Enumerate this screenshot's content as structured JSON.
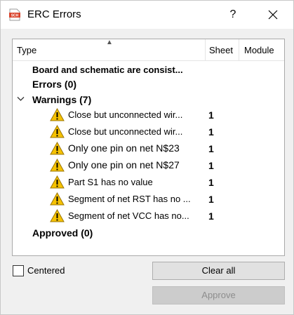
{
  "window": {
    "title": "ERC Errors",
    "help_label": "?",
    "app_icon_text": "SCH"
  },
  "table": {
    "columns": [
      "Type",
      "Sheet",
      "Module"
    ],
    "rows": [
      {
        "kind": "group",
        "label": "Board and schematic are consist..."
      },
      {
        "kind": "group",
        "label": "Errors (0)"
      },
      {
        "kind": "group",
        "label": "Warnings (7)",
        "expanded": true
      },
      {
        "kind": "warning",
        "message": "Close but unconnected wir...",
        "sheet": "1"
      },
      {
        "kind": "warning",
        "message": "Close but unconnected wir...",
        "sheet": "1"
      },
      {
        "kind": "warning",
        "message": "Only one pin on net N$23",
        "sheet": "1"
      },
      {
        "kind": "warning",
        "message": "Only one pin on net N$27",
        "sheet": "1"
      },
      {
        "kind": "warning",
        "message": "Part S1 has no value",
        "sheet": "1"
      },
      {
        "kind": "warning",
        "message": "Segment of net RST has no ...",
        "sheet": "1"
      },
      {
        "kind": "warning",
        "message": "Segment of net VCC has no...",
        "sheet": "1"
      },
      {
        "kind": "group",
        "label": "Approved (0)"
      }
    ]
  },
  "footer": {
    "centered_label": "Centered",
    "centered_checked": false,
    "clear_all_label": "Clear all",
    "approve_label": "Approve"
  },
  "colors": {
    "warning_fill": "#f6c200",
    "warning_outline": "#9a7400",
    "icon_red": "#d9432c"
  }
}
